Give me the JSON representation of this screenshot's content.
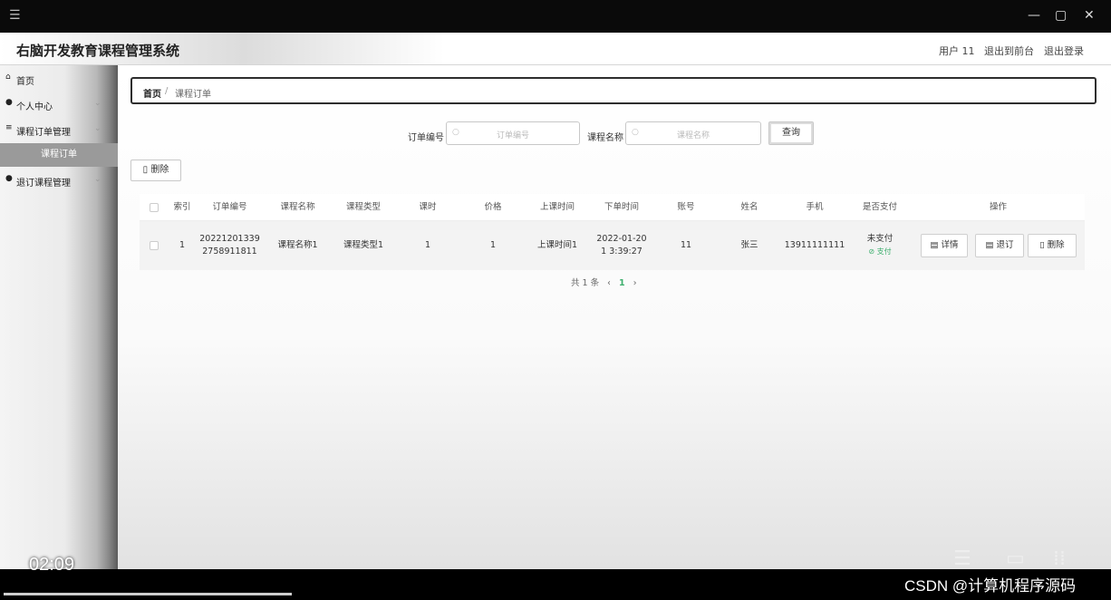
{
  "window": {
    "menu_icon": "hamburger-icon",
    "minimize": "—",
    "maximize": "▢",
    "close": "✕"
  },
  "header": {
    "app_title": "右脑开发教育课程管理系统",
    "user": "用户 11",
    "to_front": "退出到前台",
    "logout": "退出登录"
  },
  "sidebar": {
    "items": [
      {
        "icon": "home-icon",
        "label": "首页"
      },
      {
        "icon": "user-icon",
        "label": "个人中心"
      },
      {
        "icon": "list-icon",
        "label": "课程订单管理"
      },
      {
        "label": "课程订单"
      },
      {
        "icon": "pin-icon",
        "label": "退订课程管理"
      }
    ]
  },
  "breadcrumb": {
    "home": "首页",
    "separator": "/",
    "current": "课程订单"
  },
  "search": {
    "order_no_label": "订单编号",
    "order_no_placeholder": "订单编号",
    "course_label": "课程名称",
    "course_placeholder": "课程名称",
    "query_button": "查询"
  },
  "toolbar": {
    "delete_button": "删除"
  },
  "table": {
    "headers": [
      "索引",
      "订单编号",
      "课程名称",
      "课程类型",
      "课时",
      "价格",
      "上课时间",
      "下单时间",
      "账号",
      "姓名",
      "手机",
      "是否支付",
      "操作"
    ],
    "rows": [
      {
        "index": "1",
        "order_no": "20221201339 2758911811",
        "course_name": "课程名称1",
        "course_type": "课程类型1",
        "hours": "1",
        "price": "1",
        "class_time": "上课时间1",
        "order_time": "2022-01-20 1 3:39:27",
        "account": "11",
        "name": "张三",
        "phone": "13911111111",
        "paid": "未支付",
        "pay_action": "支付",
        "op_detail": "详情",
        "op_unsubscribe": "退订",
        "op_delete": "删除"
      }
    ]
  },
  "pagination": {
    "total": "共 1 条",
    "prev": "‹",
    "page": "1",
    "next": "›"
  },
  "video": {
    "time": "02:09",
    "progress": 0.26,
    "watermark": "CSDN @计算机程序源码"
  }
}
